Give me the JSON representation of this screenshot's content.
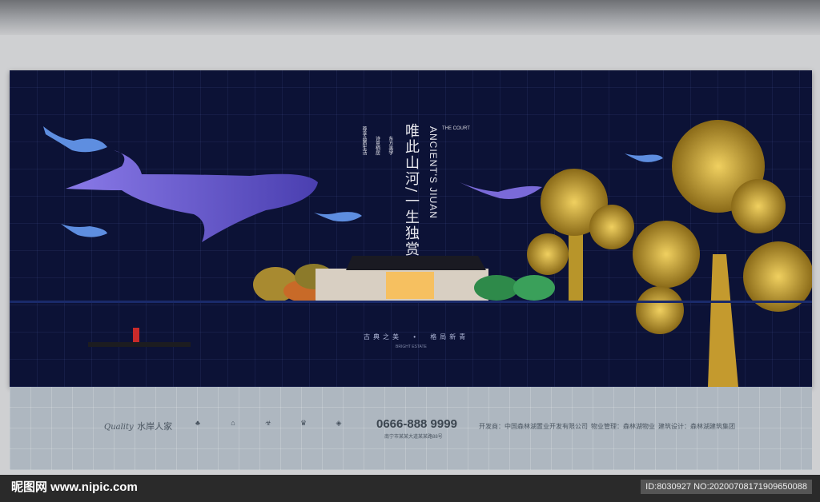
{
  "poster": {
    "headline": "唯此山河/一生独赏",
    "subtitle_en": "ANCIENT'S JIUAN",
    "corner_logo": "THE COURT",
    "left_lines": [
      "尊享品质生活",
      "诗意栖居",
      "东方美学"
    ],
    "slogan_left": "古典之美",
    "slogan_right": "格局新青",
    "slogan_en": "BRIGHT ESTATE",
    "brand_cn": "水岸人家",
    "brand_script": "Quality",
    "phone": "0666-888 9999",
    "address": "南宁市某某大道某某路88号",
    "developer_label": "开发商：",
    "developer": "中国森林湖置业开发有限公司",
    "property_label": "物业管理：",
    "property": "森林湖物业",
    "builder_label": "建筑设计：",
    "builder": "森林湖建筑集团"
  },
  "watermark": {
    "site": "昵图网 www.nipic.com",
    "id_text": "ID:8030927 NO:20200708171909650088"
  },
  "colors": {
    "board": "#0c1236",
    "gold": "#c8a23a",
    "whale": "#6a5ad0"
  }
}
